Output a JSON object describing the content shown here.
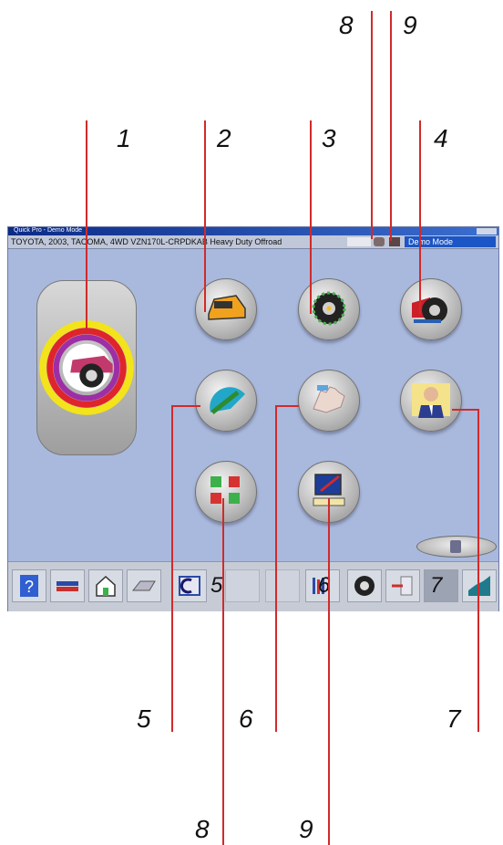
{
  "callouts": {
    "top": [
      "8",
      "9"
    ],
    "upper": [
      "1",
      "2",
      "3",
      "4"
    ],
    "lower": [
      "5",
      "6",
      "7"
    ],
    "bottom": [
      "8",
      "9"
    ]
  },
  "screen": {
    "window_title": "Quick Pro - Demo Mode",
    "vehicle": "TOYOTA, 2003, TACOMA, 4WD VZN170L-CRPDKAB Heavy Duty Offroad",
    "mode": "Demo Mode"
  },
  "toolbar": {
    "num_5": "5",
    "num_6": "6",
    "num_7": "7"
  },
  "colors": {
    "leader": "#d12a2a",
    "screen_bg": "#a9b9dd",
    "title_bar": "#0c2a86",
    "mode_bar": "#1c55c5"
  }
}
